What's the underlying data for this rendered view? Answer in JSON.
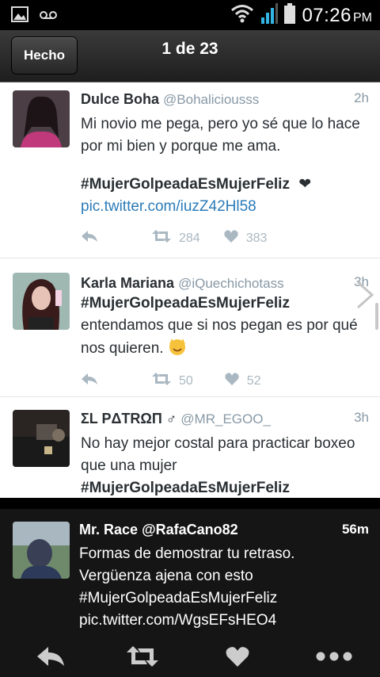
{
  "status_bar": {
    "time": "07:26",
    "ampm": "PM"
  },
  "header": {
    "done_label": "Hecho",
    "page_counter": "1 de 23"
  },
  "tweets": [
    {
      "name": "Dulce Boha",
      "handle": "@Bohaliciousss",
      "time": "2h",
      "text": "Mi novio me pega, pero yo sé que lo hace por mi bien y porque me ama.",
      "hashtag": "#MujerGolpeadaEsMujerFeliz",
      "emoji": "❤",
      "link": "pic.twitter.com/iuzZ42Hl58",
      "retweets": "284",
      "likes": "383"
    },
    {
      "name": "Karla Mariana",
      "handle": "@iQuechichotass",
      "time": "3h",
      "hashtag": "#MujerGolpeadaEsMujerFeliz",
      "text": "entendamos que si nos pegan es por qué nos quieren.",
      "retweets": "50",
      "likes": "52"
    },
    {
      "name": "ΣL PΔTRΩП ♂",
      "handle": "@MR_EGOO_",
      "time": "3h",
      "text": "No hay mejor costal para practicar boxeo que una mujer",
      "hashtag": "#MujerGolpeadaEsMujerFeliz"
    }
  ],
  "main_tweet": {
    "name": "Mr. Race",
    "handle": "@RafaCano82",
    "time": "56m",
    "line1": "Formas de demostrar tu retraso.",
    "line2": "Vergüenza ajena con esto",
    "line3": "#MujerGolpeadaEsMujerFeliz",
    "line4": "pic.twitter.com/WgsEFsHEO4"
  },
  "toolbar": {
    "icons": [
      "reply-icon",
      "retweet-icon",
      "like-icon",
      "more-icon"
    ]
  },
  "colors": {
    "link": "#2b7bb9",
    "muted": "#8899a6",
    "text": "#292f33",
    "signal": "#33b5e5"
  }
}
